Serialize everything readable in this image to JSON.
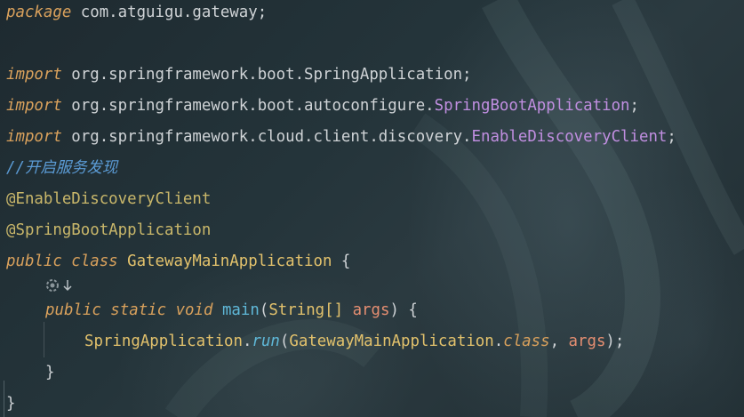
{
  "editor": {
    "lines": {
      "package_kw": "package",
      "package_name": " com.atguigu.gateway;",
      "import1_kw": "import",
      "import1_pkg": " org.springframework.boot.SpringApplication;",
      "import2_kw": "import",
      "import2_pkg": " org.springframework.boot.autoconfigure.",
      "import2_cls": "SpringBootApplication",
      "import2_end": ";",
      "import3_kw": "import",
      "import3_pkg": " org.springframework.cloud.client.discovery.",
      "import3_cls": "EnableDiscoveryClient",
      "import3_end": ";",
      "comment": "//开启服务发现",
      "annotation1": "@EnableDiscoveryClient",
      "annotation2": "@SpringBootApplication",
      "class_kw": "public class",
      "class_name": " GatewayMainApplication",
      "class_open": " {",
      "method_kw": "public static void",
      "method_name": " main",
      "method_paren_open": "(",
      "param_type": "String[]",
      "param_space": " ",
      "param_name": "args",
      "method_paren_close": ")",
      "method_open": " {",
      "call_cls": "SpringApplication",
      "call_dot": ".",
      "call_fn": "run",
      "call_open": "(",
      "call_arg_cls": "GatewayMainApplication",
      "call_arg_dot": ".",
      "call_arg_kw": "class",
      "call_sep": ", ",
      "call_arg2": "args",
      "call_close": ");",
      "method_close": "}",
      "class_close": "}"
    },
    "gutter": {
      "run_icon": "run-gutter-icon",
      "arrow_icon": "down-arrow-icon"
    }
  }
}
